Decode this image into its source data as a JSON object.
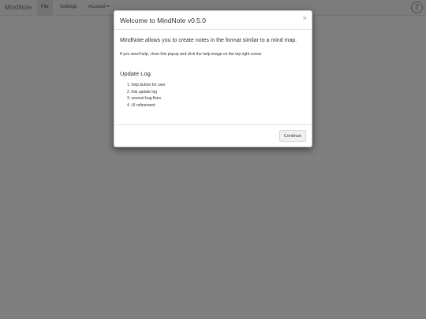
{
  "navbar": {
    "brand": "MindNote",
    "items": [
      {
        "label": "File"
      },
      {
        "label": "Settings"
      },
      {
        "label": "Account"
      }
    ],
    "help_icon": "?"
  },
  "modal": {
    "title": "Welcome to MindNote v0.5.0",
    "close": "×",
    "intro": "MindNote allows you to create notes in the format similar to a mind map.",
    "help_note": "If you need help, close this popup and click the help image on the top right corner",
    "log_heading": "Update Log",
    "log_items": [
      "1. help button for user",
      "2. this update log",
      "3. several bug fixes",
      "4. UI refinement"
    ],
    "continue_label": "Continue"
  }
}
